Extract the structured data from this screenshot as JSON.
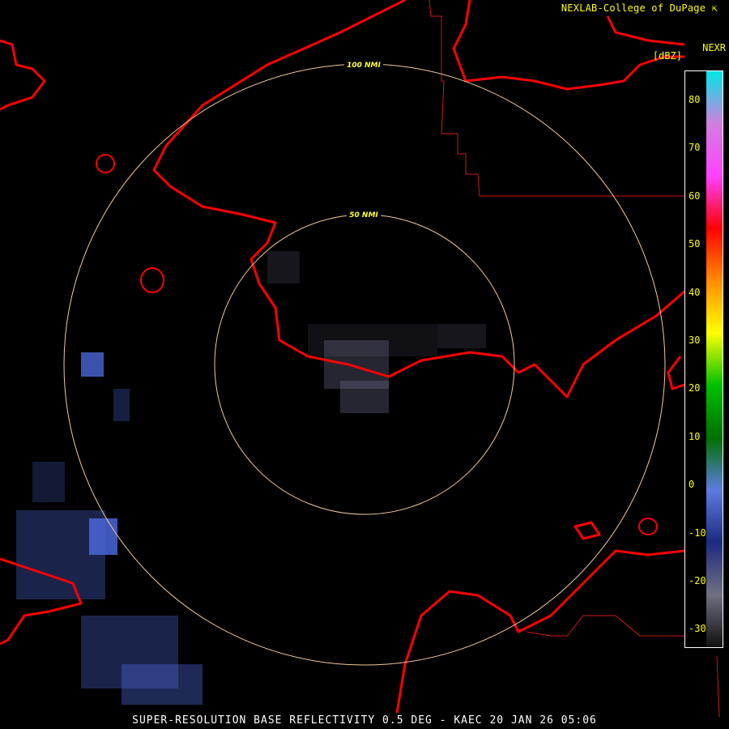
{
  "credit": "NEXLAB-College of DuPage",
  "credit_icon": "external-link-icon",
  "product": "NEXR",
  "units": "[dBZ]",
  "footer": "SUPER-RESOLUTION BASE REFLECTIVITY 0.5 DEG - KAEC 20 JAN 26 05:06",
  "range_rings": [
    {
      "label": "50 NMI"
    },
    {
      "label": "100 NMI"
    }
  ],
  "colorbar": {
    "ticks": [
      "80",
      "70",
      "60",
      "50",
      "40",
      "30",
      "20",
      "10",
      "0",
      "-10",
      "-20",
      "-30"
    ],
    "stops": [
      {
        "color": "#00e5e5"
      },
      {
        "color": "#d080e0"
      },
      {
        "color": "#ff40ff"
      },
      {
        "color": "#ff0000"
      },
      {
        "color": "#ff8c00"
      },
      {
        "color": "#ffff00"
      },
      {
        "color": "#00c000"
      },
      {
        "color": "#007000"
      },
      {
        "color": "#5c7ce0"
      },
      {
        "color": "#1c2a80"
      },
      {
        "color": "#707080"
      },
      {
        "color": "#101010"
      }
    ]
  },
  "colors": {
    "background": "#000000",
    "coastline": "#ff0000",
    "border": "#d01818",
    "ring": "#f0c8a0",
    "label": "#ffff00"
  }
}
